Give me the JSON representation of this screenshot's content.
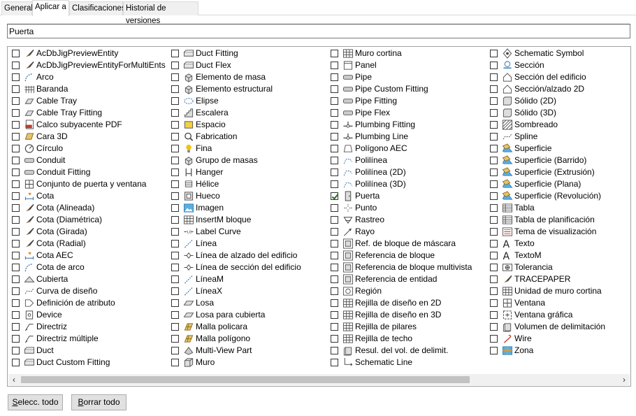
{
  "tabs": [
    "General",
    "Aplicar a",
    "Clasificaciones",
    "Historial de versiones"
  ],
  "search": {
    "value": "Puerta"
  },
  "columns": [
    [
      {
        "label": "AcDbJigPreviewEntity",
        "icon": "brush"
      },
      {
        "label": "AcDbJigPreviewEntityForMultiEnts",
        "icon": "brush"
      },
      {
        "label": "Arco",
        "icon": "arc"
      },
      {
        "label": "Baranda",
        "icon": "railing"
      },
      {
        "label": "Cable Tray",
        "icon": "tray"
      },
      {
        "label": "Cable Tray Fitting",
        "icon": "tray"
      },
      {
        "label": "Calco subyacente PDF",
        "icon": "pdf"
      },
      {
        "label": "Cara 3D",
        "icon": "face3d"
      },
      {
        "label": "Círculo",
        "icon": "circle"
      },
      {
        "label": "Conduit",
        "icon": "pipe"
      },
      {
        "label": "Conduit Fitting",
        "icon": "pipe"
      },
      {
        "label": "Conjunto de puerta y ventana",
        "icon": "window"
      },
      {
        "label": "Cota",
        "icon": "dim"
      },
      {
        "label": "Cota (Alineada)",
        "icon": "brush"
      },
      {
        "label": "Cota (Diamétrica)",
        "icon": "brush"
      },
      {
        "label": "Cota (Girada)",
        "icon": "brush"
      },
      {
        "label": "Cota (Radial)",
        "icon": "brush"
      },
      {
        "label": "Cota AEC",
        "icon": "dim"
      },
      {
        "label": "Cota de arco",
        "icon": "arc"
      },
      {
        "label": "Cubierta",
        "icon": "roof"
      },
      {
        "label": "Curva de diseño",
        "icon": "curve"
      },
      {
        "label": "Definición de atributo",
        "icon": "tag"
      },
      {
        "label": "Device",
        "icon": "device"
      },
      {
        "label": "Directriz",
        "icon": "leader"
      },
      {
        "label": "Directriz múltiple",
        "icon": "leader"
      },
      {
        "label": "Duct",
        "icon": "duct"
      },
      {
        "label": "Duct Custom Fitting",
        "icon": "duct"
      }
    ],
    [
      {
        "label": "Duct Fitting",
        "icon": "duct"
      },
      {
        "label": "Duct Flex",
        "icon": "duct"
      },
      {
        "label": "Elemento de masa",
        "icon": "mass"
      },
      {
        "label": "Elemento estructural",
        "icon": "mass"
      },
      {
        "label": "Elipse",
        "icon": "ellipse"
      },
      {
        "label": "Escalera",
        "icon": "stair"
      },
      {
        "label": "Espacio",
        "icon": "space"
      },
      {
        "label": "Fabrication",
        "icon": "search"
      },
      {
        "label": "Fina",
        "icon": "bulb"
      },
      {
        "label": "Grupo de masas",
        "icon": "mass"
      },
      {
        "label": "Hanger",
        "icon": "hanger"
      },
      {
        "label": "Hélice",
        "icon": "helix"
      },
      {
        "label": "Hueco",
        "icon": "opening"
      },
      {
        "label": "Imagen",
        "icon": "image"
      },
      {
        "label": "InsertM bloque",
        "icon": "grid"
      },
      {
        "label": "Label Curve",
        "icon": "labelcurve"
      },
      {
        "label": "Línea",
        "icon": "line"
      },
      {
        "label": "Línea de alzado del edificio",
        "icon": "elevline"
      },
      {
        "label": "Línea de sección del edificio",
        "icon": "elevline"
      },
      {
        "label": "LíneaM",
        "icon": "line"
      },
      {
        "label": "LíneaX",
        "icon": "line"
      },
      {
        "label": "Losa",
        "icon": "slab"
      },
      {
        "label": "Losa para cubierta",
        "icon": "slab"
      },
      {
        "label": "Malla policara",
        "icon": "mesh"
      },
      {
        "label": "Malla polígono",
        "icon": "mesh"
      },
      {
        "label": "Multi-View Part",
        "icon": "part"
      },
      {
        "label": "Muro",
        "icon": "wall"
      }
    ],
    [
      {
        "label": "Muro cortina",
        "icon": "grid"
      },
      {
        "label": "Panel",
        "icon": "panel"
      },
      {
        "label": "Pipe",
        "icon": "pipe"
      },
      {
        "label": "Pipe Custom Fitting",
        "icon": "pipe"
      },
      {
        "label": "Pipe Fitting",
        "icon": "pipe"
      },
      {
        "label": "Pipe Flex",
        "icon": "pipe"
      },
      {
        "label": "Plumbing Fitting",
        "icon": "plumb"
      },
      {
        "label": "Plumbing Line",
        "icon": "plumb"
      },
      {
        "label": "Polígono AEC",
        "icon": "polygon"
      },
      {
        "label": "Polilínea",
        "icon": "polyline"
      },
      {
        "label": "Polilínea (2D)",
        "icon": "polyline"
      },
      {
        "label": "Polilínea (3D)",
        "icon": "polyline"
      },
      {
        "label": "Puerta",
        "icon": "door",
        "checked": true
      },
      {
        "label": "Punto",
        "icon": "point"
      },
      {
        "label": "Rastreo",
        "icon": "trace"
      },
      {
        "label": "Rayo",
        "icon": "ray"
      },
      {
        "label": "Ref. de bloque de máscara",
        "icon": "blockref"
      },
      {
        "label": "Referencia de bloque",
        "icon": "blockref"
      },
      {
        "label": "Referencia de bloque multivista",
        "icon": "blockref"
      },
      {
        "label": "Referencia de entidad",
        "icon": "blockref"
      },
      {
        "label": "Región",
        "icon": "region"
      },
      {
        "label": "Rejilla de diseño en 2D",
        "icon": "grid"
      },
      {
        "label": "Rejilla de diseño en 3D",
        "icon": "grid"
      },
      {
        "label": "Rejilla de pilares",
        "icon": "grid"
      },
      {
        "label": "Rejilla de techo",
        "icon": "grid"
      },
      {
        "label": "Resul. del vol. de delimit.",
        "icon": "volume"
      },
      {
        "label": "Schematic Line",
        "icon": "schemline"
      }
    ],
    [
      {
        "label": "Schematic Symbol",
        "icon": "schemsym"
      },
      {
        "label": "Sección",
        "icon": "section"
      },
      {
        "label": "Sección del edificio",
        "icon": "house"
      },
      {
        "label": "Sección/alzado 2D",
        "icon": "house"
      },
      {
        "label": "Sólido (2D)",
        "icon": "solid"
      },
      {
        "label": "Sólido (3D)",
        "icon": "solid"
      },
      {
        "label": "Sombreado",
        "icon": "hatch"
      },
      {
        "label": "Spline",
        "icon": "curve"
      },
      {
        "label": "Superficie",
        "icon": "surface"
      },
      {
        "label": "Superficie (Barrido)",
        "icon": "surface"
      },
      {
        "label": "Superficie (Extrusión)",
        "icon": "surface"
      },
      {
        "label": "Superficie (Plana)",
        "icon": "surface"
      },
      {
        "label": "Superficie (Revolución)",
        "icon": "surface"
      },
      {
        "label": "Tabla",
        "icon": "table"
      },
      {
        "label": "Tabla de planificación",
        "icon": "table"
      },
      {
        "label": "Tema de visualización",
        "icon": "theme"
      },
      {
        "label": "Texto",
        "icon": "text"
      },
      {
        "label": "TextoM",
        "icon": "text"
      },
      {
        "label": "Tolerancia",
        "icon": "tolerance"
      },
      {
        "label": "TRACEPAPER",
        "icon": "brush"
      },
      {
        "label": "Unidad de muro cortina",
        "icon": "grid"
      },
      {
        "label": "Ventana",
        "icon": "window"
      },
      {
        "label": "Ventana gráfica",
        "icon": "viewport"
      },
      {
        "label": "Volumen de delimitación",
        "icon": "volume"
      },
      {
        "label": "Wire",
        "icon": "wire"
      },
      {
        "label": "Zona",
        "icon": "zone"
      }
    ]
  ],
  "buttons": {
    "select_all": {
      "underline": "S",
      "rest": "elecc. todo"
    },
    "clear_all": {
      "underline": "B",
      "rest": "orrar todo"
    }
  },
  "scrollbar": {
    "left_arrow": "‹",
    "right_arrow": "›"
  }
}
